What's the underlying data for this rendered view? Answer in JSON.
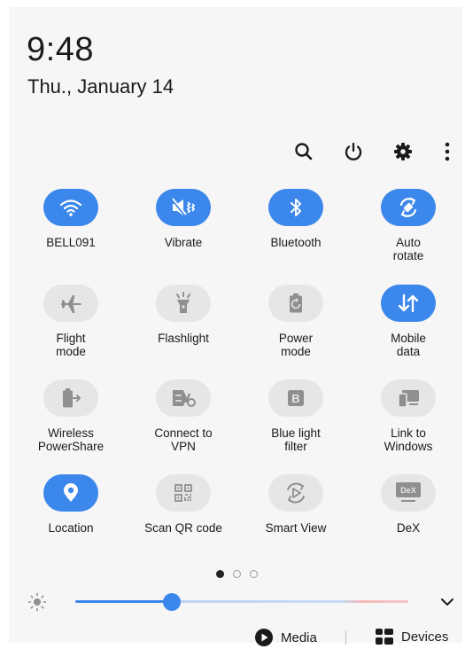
{
  "header": {
    "time": "9:48",
    "date": "Thu., January 14"
  },
  "toolbar": {
    "icons": [
      "search-icon",
      "power-icon",
      "gear-icon",
      "more-vertical-icon"
    ]
  },
  "tiles": [
    {
      "label": "BELL091",
      "active": true,
      "icon": "wifi-icon"
    },
    {
      "label": "Vibrate",
      "active": true,
      "icon": "vibrate-icon"
    },
    {
      "label": "Bluetooth",
      "active": true,
      "icon": "bluetooth-icon"
    },
    {
      "label": "Auto\nrotate",
      "active": true,
      "icon": "auto-rotate-icon"
    },
    {
      "label": "Flight\nmode",
      "active": false,
      "icon": "airplane-icon"
    },
    {
      "label": "Flashlight",
      "active": false,
      "icon": "flashlight-icon"
    },
    {
      "label": "Power\nmode",
      "active": false,
      "icon": "battery-icon"
    },
    {
      "label": "Mobile\ndata",
      "active": true,
      "icon": "mobile-data-icon"
    },
    {
      "label": "Wireless\nPowerShare",
      "active": false,
      "icon": "powershare-icon"
    },
    {
      "label": "Connect to\nVPN",
      "active": false,
      "icon": "vpn-icon"
    },
    {
      "label": "Blue light\nfilter",
      "active": false,
      "icon": "blue-light-icon"
    },
    {
      "label": "Link to\nWindows",
      "active": false,
      "icon": "link-windows-icon"
    },
    {
      "label": "Location",
      "active": true,
      "icon": "location-icon"
    },
    {
      "label": "Scan QR code",
      "active": false,
      "icon": "qr-code-icon"
    },
    {
      "label": "Smart View",
      "active": false,
      "icon": "smart-view-icon"
    },
    {
      "label": "DeX",
      "active": false,
      "icon": "dex-icon",
      "badge": "DeX"
    }
  ],
  "pager": {
    "pages": 3,
    "current": 0
  },
  "brightness": {
    "level": 0.29
  },
  "footer": {
    "media_label": "Media",
    "devices_label": "Devices"
  },
  "colors": {
    "accent": "#3c87eb",
    "inactive_tile": "#e6e6e6",
    "inactive_icon": "#8f8f8f"
  }
}
